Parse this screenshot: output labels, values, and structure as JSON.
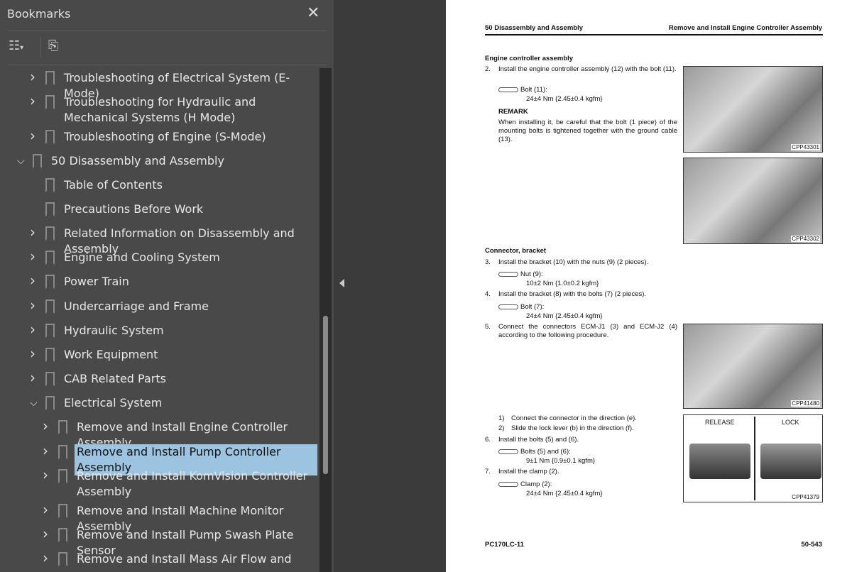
{
  "sidebar": {
    "title": "Bookmarks",
    "close_icon": "close-icon",
    "options_icon": "list-options-icon",
    "find_icon": "find-bookmark-icon",
    "items": [
      {
        "label": "Troubleshooting of Electrical System (E-Mode)",
        "level": 1,
        "state": "collapsed"
      },
      {
        "label": "Troubleshooting for Hydraulic and Mechanical Systems (H Mode)",
        "level": 1,
        "state": "collapsed"
      },
      {
        "label": "Troubleshooting of Engine (S-Mode)",
        "level": 1,
        "state": "collapsed"
      },
      {
        "label": "50 Disassembly and Assembly",
        "level": 0,
        "state": "expanded"
      },
      {
        "label": "Table of Contents",
        "level": 1,
        "state": "leaf"
      },
      {
        "label": "Precautions Before Work",
        "level": 1,
        "state": "leaf"
      },
      {
        "label": "Related Information on Disassembly and Assembly",
        "level": 1,
        "state": "collapsed"
      },
      {
        "label": "Engine and Cooling System",
        "level": 1,
        "state": "collapsed"
      },
      {
        "label": "Power Train",
        "level": 1,
        "state": "collapsed"
      },
      {
        "label": "Undercarriage and Frame",
        "level": 1,
        "state": "collapsed"
      },
      {
        "label": "Hydraulic System",
        "level": 1,
        "state": "collapsed"
      },
      {
        "label": "Work Equipment",
        "level": 1,
        "state": "collapsed"
      },
      {
        "label": "CAB Related Parts",
        "level": 1,
        "state": "collapsed"
      },
      {
        "label": "Electrical System",
        "level": 1,
        "state": "expanded"
      },
      {
        "label": "Remove and Install Engine Controller Assembly",
        "level": 2,
        "state": "collapsed"
      },
      {
        "label": "Remove and Install Pump Controller Assembly",
        "level": 2,
        "state": "collapsed",
        "selected": true
      },
      {
        "label": "Remove and Install KomVision Controller Assembly",
        "level": 2,
        "state": "collapsed"
      },
      {
        "label": "Remove and Install Machine Monitor Assembly",
        "level": 2,
        "state": "collapsed"
      },
      {
        "label": "Remove and Install Pump Swash Plate Sensor",
        "level": 2,
        "state": "collapsed"
      },
      {
        "label": "Remove and Install Mass Air Flow and",
        "level": 2,
        "state": "collapsed"
      }
    ]
  },
  "page": {
    "header_left": "50 Disassembly and Assembly",
    "header_right": "Remove and Install Engine Controller Assembly",
    "s1": "Engine controller assembly",
    "p2n": "2.",
    "p2": "Install the engine controller assembly (12) with the bolt (11).",
    "t1": "Bolt (11):",
    "v1": "24±4 Nm {2.45±0.4 kgfm}",
    "remark": "REMARK",
    "remark_text": "When installing it, be careful that the bolt (1 piece) of the mounting bolts is tightened together with the ground cable (13).",
    "s2": "Connector, bracket",
    "p3n": "3.",
    "p3": "Install the bracket (10) with the nuts (9) (2 pieces).",
    "t3": "Nut (9):",
    "v3": "10±2 Nm {1.0±0.2 kgfm}",
    "p4n": "4.",
    "p4": "Install the bracket (8) with the bolts (7) (2 pieces).",
    "t4": "Bolt (7):",
    "v4": "24±4 Nm {2.45±0.4 kgfm}",
    "p5n": "5.",
    "p5": "Connect the connectors ECM-J1 (3) and ECM-J2 (4) according to the following procedure.",
    "s51n": "1)",
    "s51": "Connect the connector in the direction (e).",
    "s52n": "2)",
    "s52": "Slide the lock lever (b) in the direction (f).",
    "p6n": "6.",
    "p6": "Install the bolts (5) and (6).",
    "t6": "Bolts (5) and (6):",
    "v6": "9±1 Nm {0.9±0.1 kgfm}",
    "p7n": "7.",
    "p7": "Install the clamp (2).",
    "t7": "Clamp (2):",
    "v7": "24±4 Nm {2.45±0.4 kgfm}",
    "fig1": "CPP43301",
    "fig2": "CPP43302",
    "fig3": "CPP41480",
    "fig4": "CPP41379",
    "release": "RELEASE",
    "lock": "LOCK",
    "footer_left": "PC170LC-11",
    "footer_right": "50-543"
  }
}
